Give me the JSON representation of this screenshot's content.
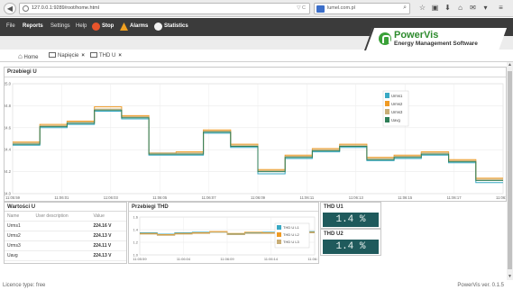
{
  "browser": {
    "url": "127.0.0.1:9289/root/home.html",
    "url_controls": "▽ C",
    "search_text": "lumel.com.pl",
    "search_engine": "8"
  },
  "menu": {
    "file": "File",
    "reports": "Reports",
    "settings": "Settings",
    "help": "Help",
    "stop": "Stop",
    "alarms": "Alarms",
    "statistics": "Statistics"
  },
  "logo": {
    "title": "PowerVis",
    "subtitle": "Energy Management Software"
  },
  "tabs": [
    {
      "label": "Home"
    },
    {
      "label": "Napięcie",
      "close": "×"
    },
    {
      "label": "THD U",
      "close": "×"
    }
  ],
  "chart_main": {
    "title": "Przebiegi U",
    "colors": {
      "Urms1": "#39a9c4",
      "Urms2": "#ef9a23",
      "Urms3": "#c8ad76",
      "Uavg": "#2e7e57"
    }
  },
  "chart_data": [
    {
      "type": "line",
      "title": "Przebiegi U",
      "y_ticks": [
        "224.0",
        "224.2",
        "224.4",
        "224.6",
        "224.8",
        "225.0"
      ],
      "ylim": [
        224.0,
        225.0
      ],
      "x": [
        "11:05:59",
        "11:06:01",
        "11:06:03",
        "11:06:05",
        "11:06:07",
        "11:06:09",
        "11:06:11",
        "11:06:13",
        "11:06:15",
        "11:06:17",
        "11:06:19"
      ],
      "x_ticks": [
        "11:05:59",
        "11:06:01",
        "11:06:03",
        "11:06:05",
        "11:06:07",
        "11:06:09",
        "11:06:11",
        "11:06:13",
        "11:06:15",
        "11:06:17",
        "11:06:19"
      ],
      "series": [
        {
          "name": "Urms1",
          "values": [
            224.44,
            224.6,
            224.63,
            224.75,
            224.68,
            224.35,
            224.35,
            224.55,
            224.42,
            224.18,
            224.32,
            224.38,
            224.42,
            224.3,
            224.32,
            224.35,
            224.28,
            224.1
          ]
        },
        {
          "name": "Urms2",
          "values": [
            224.47,
            224.63,
            224.66,
            224.79,
            224.71,
            224.37,
            224.38,
            224.58,
            224.45,
            224.22,
            224.35,
            224.41,
            224.45,
            224.33,
            224.35,
            224.38,
            224.31,
            224.14
          ]
        },
        {
          "name": "Urms3",
          "values": [
            224.46,
            224.62,
            224.65,
            224.77,
            224.7,
            224.37,
            224.37,
            224.57,
            224.44,
            224.21,
            224.34,
            224.4,
            224.44,
            224.32,
            224.34,
            224.37,
            224.3,
            224.13
          ]
        },
        {
          "name": "Uavg",
          "values": [
            224.45,
            224.61,
            224.64,
            224.76,
            224.69,
            224.36,
            224.36,
            224.56,
            224.43,
            224.2,
            224.33,
            224.39,
            224.43,
            224.31,
            224.33,
            224.36,
            224.29,
            224.12
          ]
        }
      ],
      "legend_position": "top-right",
      "grid": true
    },
    {
      "type": "line",
      "title": "Przebiegi THD",
      "y_ticks": [
        "1.0",
        "1.2",
        "1.4",
        "1.6"
      ],
      "ylim": [
        1.0,
        1.6
      ],
      "x_ticks": [
        "11:05:59",
        "11:06:04",
        "11:06:09",
        "11:06:14",
        "11:06:19"
      ],
      "series": [
        {
          "name": "THD U L1",
          "values": [
            1.35,
            1.33,
            1.35,
            1.36,
            1.36,
            1.33,
            1.35,
            1.36,
            1.38,
            1.37
          ]
        },
        {
          "name": "THD U L2",
          "values": [
            1.34,
            1.32,
            1.34,
            1.35,
            1.37,
            1.34,
            1.36,
            1.35,
            1.37,
            1.36
          ]
        },
        {
          "name": "THD U L3",
          "values": [
            1.33,
            1.31,
            1.33,
            1.34,
            1.36,
            1.32,
            1.34,
            1.34,
            1.36,
            1.35
          ]
        }
      ],
      "legend_position": "right",
      "grid": true
    }
  ],
  "values_panel": {
    "title": "Wartości U",
    "headers": [
      "Name",
      "User description",
      "Value"
    ],
    "rows": [
      {
        "name": "Urms1",
        "desc": "",
        "value": "224.16 V"
      },
      {
        "name": "Urms2",
        "desc": "",
        "value": "224.13 V"
      },
      {
        "name": "Urms3",
        "desc": "",
        "value": "224.11 V"
      },
      {
        "name": "Uavg",
        "desc": "",
        "value": "224.13 V"
      }
    ]
  },
  "thd_chart": {
    "title": "Przebiegi THD",
    "colors": {
      "THD U L1": "#39a9c4",
      "THD U L2": "#ef9a23",
      "THD U L3": "#c8ad76"
    }
  },
  "thd_u1": {
    "title": "THD U1",
    "value": "1.4 %"
  },
  "thd_u2": {
    "title": "THD U2",
    "value": "1.4 %"
  },
  "footer": {
    "licence": "Licence type: free",
    "version": "PowerVis ver. 0.1.5"
  }
}
